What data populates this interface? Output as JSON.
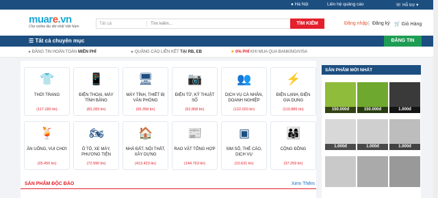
{
  "topbar": {
    "location": "Hà Nội",
    "ads": "Liên hệ quảng cáo",
    "help": "Hỗ trợ"
  },
  "header": {
    "logo_pre": "muar",
    "logo_mid": "e",
    "logo_post": ".vn",
    "slogan": "Chợ online lâu đời nhất Việt Nam",
    "search_category": "Tất cả",
    "search_placeholder": "Tìm kiếm...",
    "search_button": "TÌM KIẾM",
    "login": "Đăng nhập",
    "register": "Đăng ký",
    "cart": "Giỏ Hàng"
  },
  "catbar": {
    "menu": "Tất cả chuyên mục",
    "post": "ĐĂNG TIN"
  },
  "notices": [
    {
      "pre": "ĐĂNG TIN HOÀN TOÀN ",
      "bold": "MIỄN PHÍ"
    },
    {
      "pre": "QUẢNG CÁO LIÊN KẾT ",
      "bold": "TẠI RB, EB"
    },
    {
      "pre": "0% PHÍ",
      "bold": " KHI MUA QUA BANKING/VISA"
    }
  ],
  "categories": [
    {
      "name": "THỜI TRANG",
      "count": "(117.180 tin)",
      "icon": "shirt-icon"
    },
    {
      "name": "ĐIỆN THOẠI, MÁY TÍNH BẢNG",
      "count": "(83.283 tin)",
      "icon": "phone-icon"
    },
    {
      "name": "MÁY TÍNH, THIẾT BỊ VĂN PHÒNG",
      "count": "(95.358 tin)",
      "icon": "computer-icon"
    },
    {
      "name": "ĐIỆN TỬ, KỸ THUẬT SỐ",
      "count": "(52.858 tin)",
      "icon": "camera-icon"
    },
    {
      "name": "DỊCH VỤ CÁ NHÂN, DOANH NGHIỆP",
      "count": "(122.020 tin)",
      "icon": "service-icon"
    },
    {
      "name": "ĐIỆN LẠNH, ĐIỆN GIA DỤNG",
      "count": "(110.885 tin)",
      "icon": "kettle-icon"
    },
    {
      "name": "ĂN UỐNG, VUI CHƠI",
      "count": "(35.450 tin)",
      "icon": "drink-icon"
    },
    {
      "name": "Ô TÔ, XE MÁY, PHƯƠNG TIỆN",
      "count": "(72.990 tin)",
      "icon": "motorbike-icon"
    },
    {
      "name": "NHÀ ĐẤT, NỘI THẤT, XÂY DỰNG",
      "count": "(413.423 tin)",
      "icon": "house-icon"
    },
    {
      "name": "RAO VẶT TỔNG HỢP",
      "count": "(144.763 tin)",
      "icon": "newspaper-icon"
    },
    {
      "name": "SIM SỐ, THẺ CÀO, DỊCH VỤ",
      "count": "(10.631 tin)",
      "icon": "sim-icon"
    },
    {
      "name": "CỘNG ĐỒNG",
      "count": "(37.259 tin)",
      "icon": "community-icon"
    }
  ],
  "featured": {
    "title": "SẢN PHẨM ĐỘC ĐÁO",
    "more": "Xem Thêm"
  },
  "sidebar": {
    "title": "SẢN PHẨM MỚI NHẤT",
    "items": [
      {
        "price": "150.000đ",
        "color": "#8fbc3a"
      },
      {
        "price": "150.000đ",
        "color": "#6fa82e"
      },
      {
        "price": "1.000đ",
        "color": "#3a3a3a"
      },
      {
        "price": "1.000đ",
        "color": "#d8d8d8"
      },
      {
        "price": "1.000đ",
        "color": "#cfcfcf"
      },
      {
        "price": "1.000đ",
        "color": "#bdbdbd"
      },
      {
        "price": "",
        "color": "#c9c9c9"
      },
      {
        "price": "",
        "color": "#aaaaaa"
      },
      {
        "price": "",
        "color": "#999999"
      }
    ]
  }
}
